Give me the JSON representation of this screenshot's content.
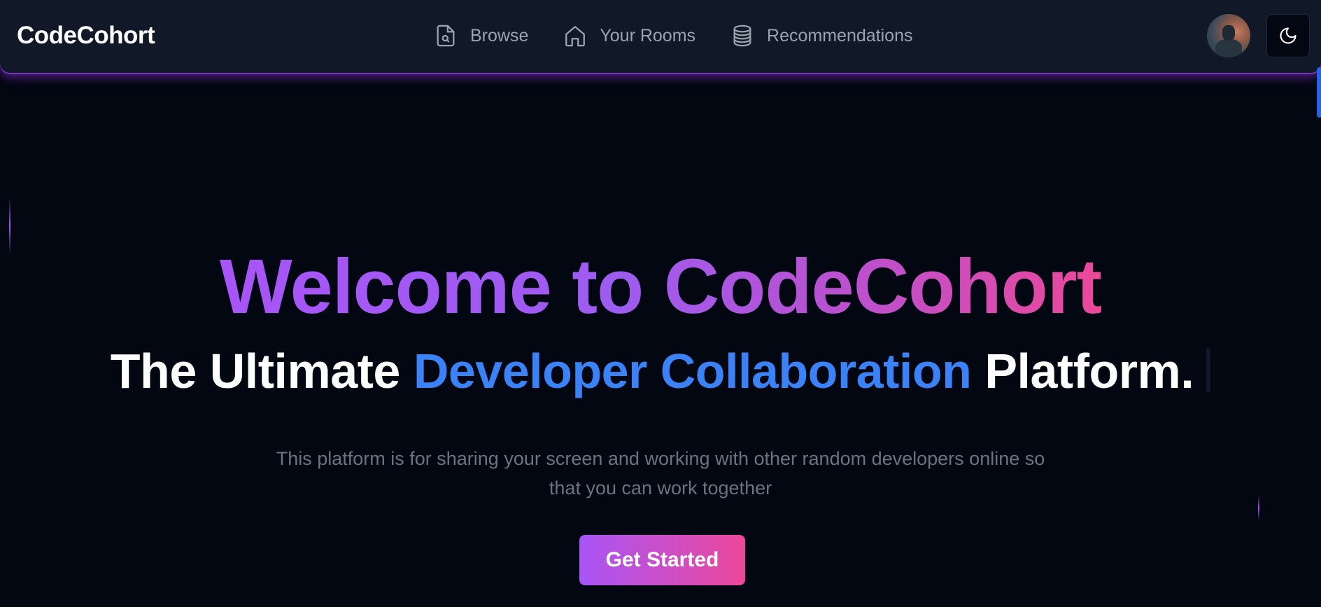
{
  "app": {
    "logo": "CodeCohort"
  },
  "nav": {
    "items": [
      {
        "label": "Browse",
        "icon": "file-search-icon"
      },
      {
        "label": "Your Rooms",
        "icon": "home-icon"
      },
      {
        "label": "Recommendations",
        "icon": "database-icon"
      }
    ]
  },
  "header": {
    "avatar": "user-avatar",
    "theme_toggle_icon": "moon-icon"
  },
  "hero": {
    "title": "Welcome to CodeCohort",
    "subtitle_prefix": "The Ultimate ",
    "subtitle_highlight": "Developer Collaboration",
    "subtitle_suffix": " Platform.",
    "description": "This platform is for sharing your screen and working with other random developers online so that you can work together",
    "cta_label": "Get Started"
  },
  "colors": {
    "background": "#030712",
    "navbar": "#111827",
    "gradient_start": "#a855f7",
    "gradient_end": "#ec4899",
    "highlight_blue": "#3b82f6",
    "muted_text": "#6b7280"
  }
}
